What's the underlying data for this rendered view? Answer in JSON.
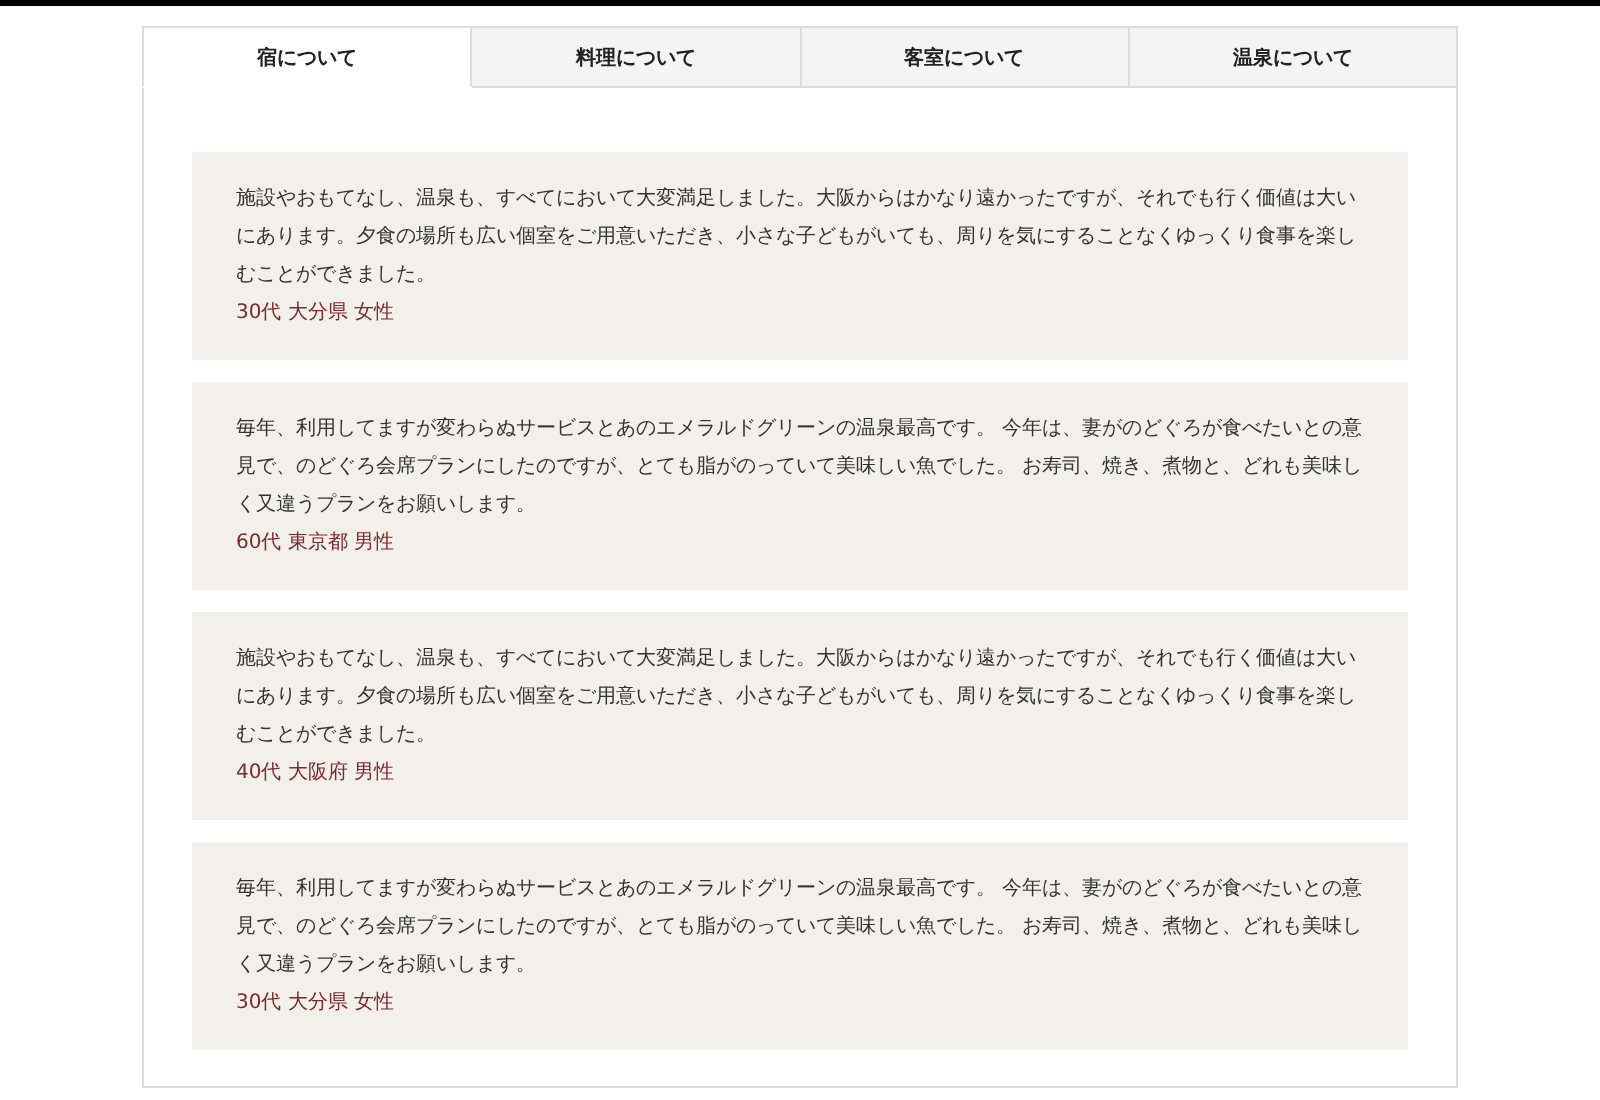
{
  "tabs": [
    {
      "label": "宿について",
      "selected": true
    },
    {
      "label": "料理について",
      "selected": false
    },
    {
      "label": "客室について",
      "selected": false
    },
    {
      "label": "温泉について",
      "selected": false
    }
  ],
  "reviews": [
    {
      "text": "施設やおもてなし、温泉も、すべてにおいて大変満足しました。大阪からはかなり遠かったですが、それでも行く価値は大いにあります。夕食の場所も広い個室をご用意いただき、小さな子どもがいても、周りを気にすることなくゆっくり食事を楽しむことができました。",
      "author": "30代 大分県 女性"
    },
    {
      "text": "毎年、利用してますが変わらぬサービスとあのエメラルドグリーンの温泉最高です。 今年は、妻がのどぐろが食べたいとの意見で、のどぐろ会席プランにしたのですが、とても脂がのっていて美味しい魚でした。 お寿司、焼き、煮物と、どれも美味しく又違うプランをお願いします。",
      "author": "60代 東京都 男性"
    },
    {
      "text": "施設やおもてなし、温泉も、すべてにおいて大変満足しました。大阪からはかなり遠かったですが、それでも行く価値は大いにあります。夕食の場所も広い個室をご用意いただき、小さな子どもがいても、周りを気にすることなくゆっくり食事を楽しむことができました。",
      "author": "40代 大阪府 男性"
    },
    {
      "text": "毎年、利用してますが変わらぬサービスとあのエメラルドグリーンの温泉最高です。 今年は、妻がのどぐろが食べたいとの意見で、のどぐろ会席プランにしたのですが、とても脂がのっていて美味しい魚でした。 お寿司、焼き、煮物と、どれも美味しく又違うプランをお願いします。",
      "author": "30代 大分県 女性"
    }
  ]
}
